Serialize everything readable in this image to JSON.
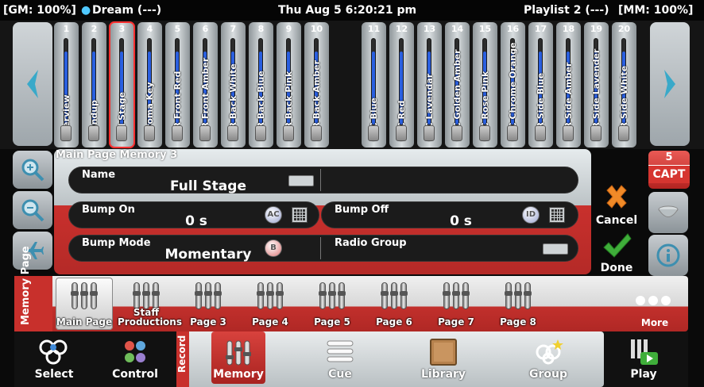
{
  "status": {
    "gm": "[GM: 100%]",
    "show": "Dream (---)",
    "datetime": "Thu Aug 5 6:20:21 pm",
    "playlist": "Playlist 2 (---)",
    "mm": "[MM: 100%]"
  },
  "faders": [
    {
      "num": "1",
      "label": "Interview",
      "level": 0.15
    },
    {
      "num": "2",
      "label": "Standup",
      "level": 0.15
    },
    {
      "num": "3",
      "label": "Full Stage",
      "level": 0.15,
      "selected": true
    },
    {
      "num": "4",
      "label": "Chroma Key",
      "level": 0.15
    },
    {
      "num": "5",
      "label": "PAR Front Red",
      "level": 0.15
    },
    {
      "num": "6",
      "label": "PAR Front Amber",
      "level": 0.15
    },
    {
      "num": "7",
      "label": "PAR Back White",
      "level": 0.15
    },
    {
      "num": "8",
      "label": "PAR Back Blue",
      "level": 0.15
    },
    {
      "num": "9",
      "label": "PAR Back Pink",
      "level": 0.15
    },
    {
      "num": "10",
      "label": "PAR Back Amber",
      "level": 0.15
    },
    {
      "num": "11",
      "label": "CYC Blue",
      "level": 0.15
    },
    {
      "num": "12",
      "label": "CYC Red",
      "level": 0.15
    },
    {
      "num": "13",
      "label": "CYC Lavendar",
      "level": 0.15
    },
    {
      "num": "14",
      "label": "CYC Golden Amber",
      "level": 0.15
    },
    {
      "num": "15",
      "label": "CYC Rose Pink",
      "level": 0.15
    },
    {
      "num": "16",
      "label": "CYC Chrome Orange",
      "level": 0.15
    },
    {
      "num": "17",
      "label": "PAR Side Blue",
      "level": 0.15
    },
    {
      "num": "18",
      "label": "PAR Side Amber",
      "level": 0.15
    },
    {
      "num": "19",
      "label": "PAR Side Lavender",
      "level": 0.15
    },
    {
      "num": "20",
      "label": "PAR Side White",
      "level": 0.15
    }
  ],
  "panel": {
    "title": "Main Page Memory 3",
    "name_label": "Name",
    "name_value": "Full Stage",
    "bump_on_label": "Bump On",
    "bump_on_value": "0 s",
    "bump_off_label": "Bump Off",
    "bump_off_value": "0 s",
    "bump_mode_label": "Bump Mode",
    "bump_mode_value": "Momentary",
    "radio_group_label": "Radio Group"
  },
  "actions": {
    "cancel": "Cancel",
    "done": "Done",
    "capt_num": "5",
    "capt": "CAPT"
  },
  "memory_page": {
    "side_label": "Memory Page",
    "pages": [
      "Main Page",
      "Staff Productions",
      "Page 3",
      "Page 4",
      "Page 5",
      "Page 6",
      "Page 7",
      "Page 8"
    ],
    "more": "More"
  },
  "toolbar": {
    "select": "Select",
    "control": "Control",
    "record": "Record",
    "memory": "Memory",
    "cue": "Cue",
    "library": "Library",
    "group": "Group",
    "play": "Play"
  },
  "colors": {
    "fader_fill": "#2a5fe0",
    "accent_red": "#c8302c",
    "selected_outline": "#ff3030",
    "done_green": "#3fae3a",
    "cancel_orange": "#f08a28"
  }
}
